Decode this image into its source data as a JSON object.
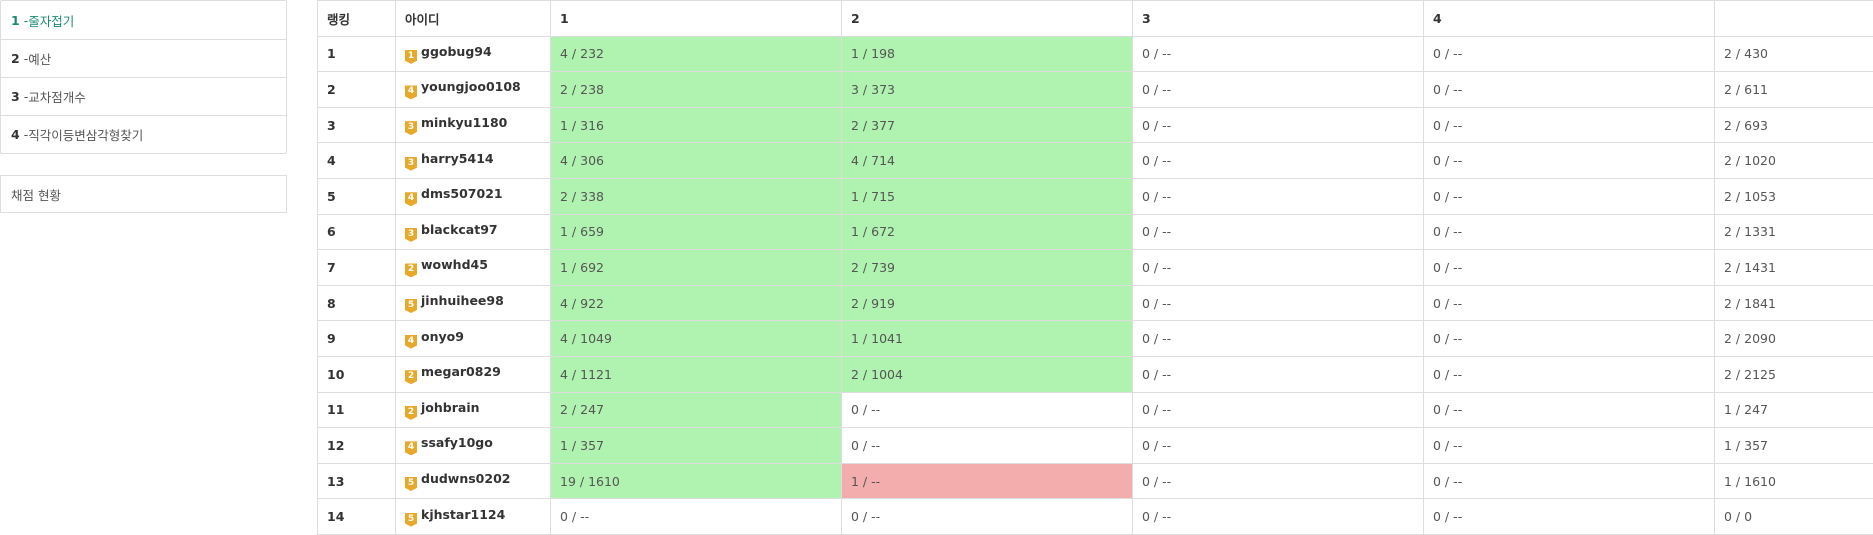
{
  "sidebar": {
    "problems": [
      {
        "num": "1",
        "title": "줄자접기",
        "active": true
      },
      {
        "num": "2",
        "title": "예산",
        "active": false
      },
      {
        "num": "3",
        "title": "교차점개수",
        "active": false
      },
      {
        "num": "4",
        "title": "직각이등변삼각형찾기",
        "active": false
      }
    ],
    "status_label": "채점 현황"
  },
  "table": {
    "headers": {
      "rank": "랭킹",
      "id": "아이디",
      "p1": "1",
      "p2": "2",
      "p3": "3",
      "p4": "4",
      "total": ""
    },
    "rows": [
      {
        "rank": "1",
        "tier": "1",
        "user": "ggobug94",
        "p1": "4 / 232",
        "p1_state": "solved",
        "p2": "1 / 198",
        "p2_state": "solved",
        "p3": "0 / --",
        "p3_state": "none",
        "p4": "0 / --",
        "p4_state": "none",
        "total": "2 / 430"
      },
      {
        "rank": "2",
        "tier": "4",
        "user": "youngjoo0108",
        "p1": "2 / 238",
        "p1_state": "solved",
        "p2": "3 / 373",
        "p2_state": "solved",
        "p3": "0 / --",
        "p3_state": "none",
        "p4": "0 / --",
        "p4_state": "none",
        "total": "2 / 611"
      },
      {
        "rank": "3",
        "tier": "3",
        "user": "minkyu1180",
        "p1": "1 / 316",
        "p1_state": "solved",
        "p2": "2 / 377",
        "p2_state": "solved",
        "p3": "0 / --",
        "p3_state": "none",
        "p4": "0 / --",
        "p4_state": "none",
        "total": "2 / 693"
      },
      {
        "rank": "4",
        "tier": "3",
        "user": "harry5414",
        "p1": "4 / 306",
        "p1_state": "solved",
        "p2": "4 / 714",
        "p2_state": "solved",
        "p3": "0 / --",
        "p3_state": "none",
        "p4": "0 / --",
        "p4_state": "none",
        "total": "2 / 1020"
      },
      {
        "rank": "5",
        "tier": "4",
        "user": "dms507021",
        "p1": "2 / 338",
        "p1_state": "solved",
        "p2": "1 / 715",
        "p2_state": "solved",
        "p3": "0 / --",
        "p3_state": "none",
        "p4": "0 / --",
        "p4_state": "none",
        "total": "2 / 1053"
      },
      {
        "rank": "6",
        "tier": "3",
        "user": "blackcat97",
        "p1": "1 / 659",
        "p1_state": "solved",
        "p2": "1 / 672",
        "p2_state": "solved",
        "p3": "0 / --",
        "p3_state": "none",
        "p4": "0 / --",
        "p4_state": "none",
        "total": "2 / 1331"
      },
      {
        "rank": "7",
        "tier": "2",
        "user": "wowhd45",
        "p1": "1 / 692",
        "p1_state": "solved",
        "p2": "2 / 739",
        "p2_state": "solved",
        "p3": "0 / --",
        "p3_state": "none",
        "p4": "0 / --",
        "p4_state": "none",
        "total": "2 / 1431"
      },
      {
        "rank": "8",
        "tier": "5",
        "user": "jinhuihee98",
        "p1": "4 / 922",
        "p1_state": "solved",
        "p2": "2 / 919",
        "p2_state": "solved",
        "p3": "0 / --",
        "p3_state": "none",
        "p4": "0 / --",
        "p4_state": "none",
        "total": "2 / 1841"
      },
      {
        "rank": "9",
        "tier": "4",
        "user": "onyo9",
        "p1": "4 / 1049",
        "p1_state": "solved",
        "p2": "1 / 1041",
        "p2_state": "solved",
        "p3": "0 / --",
        "p3_state": "none",
        "p4": "0 / --",
        "p4_state": "none",
        "total": "2 / 2090"
      },
      {
        "rank": "10",
        "tier": "2",
        "user": "megar0829",
        "p1": "4 / 1121",
        "p1_state": "solved",
        "p2": "2 / 1004",
        "p2_state": "solved",
        "p3": "0 / --",
        "p3_state": "none",
        "p4": "0 / --",
        "p4_state": "none",
        "total": "2 / 2125"
      },
      {
        "rank": "11",
        "tier": "2",
        "user": "johbrain",
        "p1": "2 / 247",
        "p1_state": "solved",
        "p2": "0 / --",
        "p2_state": "none",
        "p3": "0 / --",
        "p3_state": "none",
        "p4": "0 / --",
        "p4_state": "none",
        "total": "1 / 247"
      },
      {
        "rank": "12",
        "tier": "4",
        "user": "ssafy10go",
        "p1": "1 / 357",
        "p1_state": "solved",
        "p2": "0 / --",
        "p2_state": "none",
        "p3": "0 / --",
        "p3_state": "none",
        "p4": "0 / --",
        "p4_state": "none",
        "total": "1 / 357"
      },
      {
        "rank": "13",
        "tier": "5",
        "user": "dudwns0202",
        "p1": "19 / 1610",
        "p1_state": "solved",
        "p2": "1 / --",
        "p2_state": "wrong",
        "p3": "0 / --",
        "p3_state": "none",
        "p4": "0 / --",
        "p4_state": "none",
        "total": "1 / 1610"
      },
      {
        "rank": "14",
        "tier": "5",
        "user": "kjhstar1124",
        "p1": "0 / --",
        "p1_state": "none",
        "p2": "0 / --",
        "p2_state": "none",
        "p3": "0 / --",
        "p3_state": "none",
        "p4": "0 / --",
        "p4_state": "none",
        "total": "0 / 0"
      }
    ]
  },
  "colors": {
    "accent": "#1a8a74",
    "solved": "#b0f2b0",
    "wrong": "#f3adad",
    "tier_badge": "#e8a82a",
    "border": "#dddddd"
  }
}
